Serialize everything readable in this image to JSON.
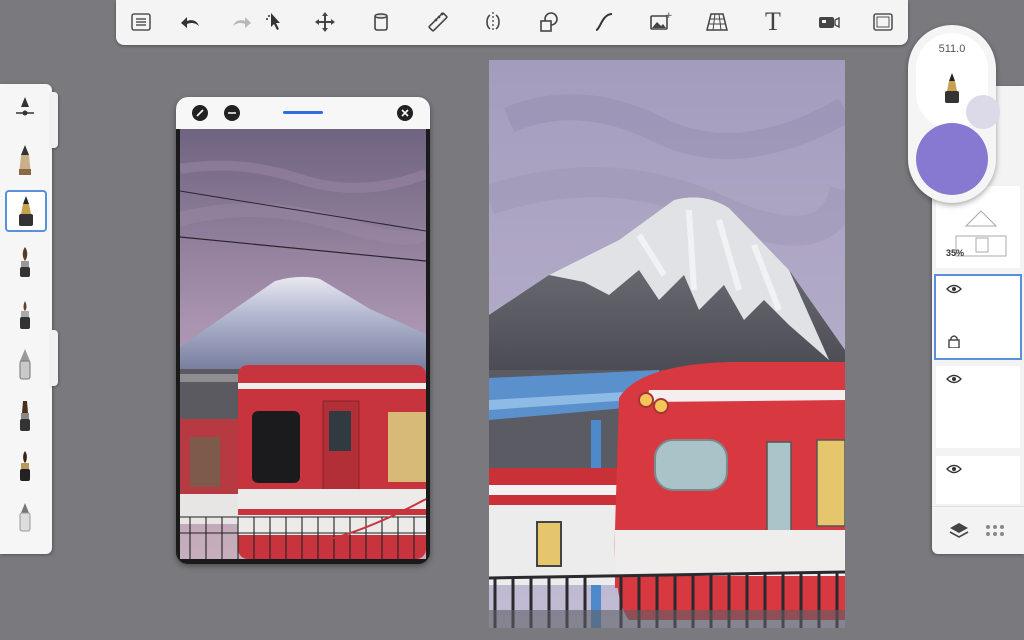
{
  "toolbar": {
    "items": [
      {
        "name": "gallery-list-icon"
      },
      {
        "name": "undo-icon"
      },
      {
        "name": "redo-icon"
      },
      {
        "name": "selection-icon"
      },
      {
        "name": "transform-icon"
      },
      {
        "name": "fill-bucket-icon"
      },
      {
        "name": "ruler-icon"
      },
      {
        "name": "symmetry-icon"
      },
      {
        "name": "shapes-icon"
      },
      {
        "name": "curve-icon"
      },
      {
        "name": "insert-image-icon"
      },
      {
        "name": "perspective-grid-icon"
      },
      {
        "name": "text-icon",
        "label": "T"
      },
      {
        "name": "video-icon"
      },
      {
        "name": "fullscreen-icon"
      }
    ]
  },
  "brush_panel": {
    "brushes": [
      {
        "name": "size-slider-icon"
      },
      {
        "name": "pencil-brush-icon"
      },
      {
        "name": "ink-pen-brush-icon",
        "selected": true
      },
      {
        "name": "paint-brush-icon"
      },
      {
        "name": "marker-brush-icon"
      },
      {
        "name": "airbrush-brush-icon"
      },
      {
        "name": "flat-brush-icon"
      },
      {
        "name": "oil-brush-icon"
      },
      {
        "name": "eraser-brush-icon"
      }
    ]
  },
  "reference_window": {
    "buttons": [
      "pin-icon",
      "minimize-icon",
      "close-icon"
    ]
  },
  "brush_popup": {
    "size": "511.0",
    "current_color": "#8778d2",
    "opacity_color": "#dcdae8"
  },
  "layers": {
    "items": [
      {
        "name": "layer-reference",
        "opacity": "35%"
      },
      {
        "name": "layer-active",
        "visible": true,
        "locked": true,
        "active": true
      },
      {
        "name": "layer-3",
        "visible": true
      },
      {
        "name": "layer-4",
        "visible": true
      }
    ],
    "footer": [
      "layers-icon",
      "grid-menu-icon"
    ]
  },
  "colors": {
    "accent": "#5a8fdc",
    "sky": "#b3a9c7",
    "train_red": "#d94149"
  }
}
